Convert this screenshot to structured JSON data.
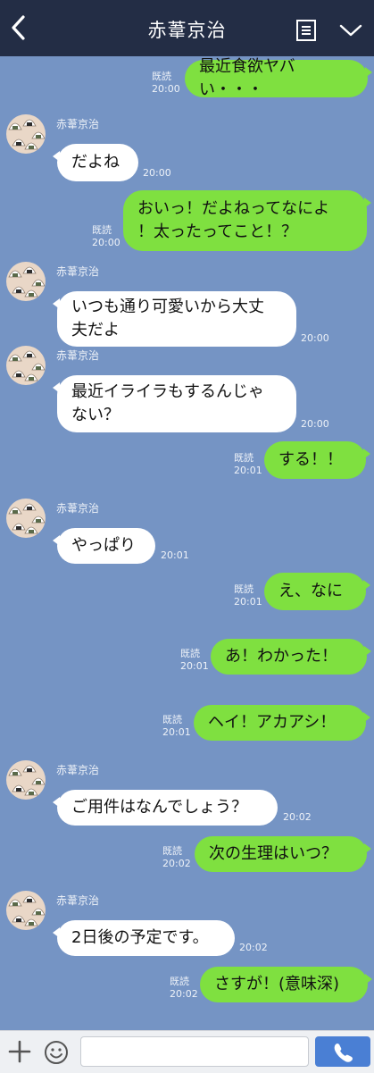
{
  "header": {
    "title": "赤葦京治",
    "back_icon": "chevron-left-icon",
    "menu_icon": "note-icon",
    "more_icon": "chevron-down-icon",
    "bg_color": "#232d45"
  },
  "chat": {
    "bg_color": "#7594c4",
    "read_label": "既読",
    "contact_name": "赤葦京治",
    "messages": [
      {
        "dir": "out",
        "text": "最近食欲ヤバい・・・",
        "time": "20:00",
        "read": "既読"
      },
      {
        "dir": "in",
        "sender": "赤葦京治",
        "text": "だよね",
        "time": "20:00"
      },
      {
        "dir": "out",
        "text": "おいっ！だよねってなによ\n！太ったってこと！？",
        "time": "20:00",
        "read": "既読"
      },
      {
        "dir": "in",
        "sender": "赤葦京治",
        "text": "いつも通り可愛いから大丈\n夫だよ",
        "time": "20:00"
      },
      {
        "dir": "in",
        "sender": "赤葦京治",
        "text": "最近イライラもするんじゃ\nない？",
        "time": "20:00"
      },
      {
        "dir": "out",
        "text": "する！！",
        "time": "20:01",
        "read": "既読"
      },
      {
        "dir": "in",
        "sender": "赤葦京治",
        "text": "やっぱり",
        "time": "20:01"
      },
      {
        "dir": "out",
        "text": "え、なに",
        "time": "20:01",
        "read": "既読"
      },
      {
        "dir": "out",
        "text": "あ！わかった！",
        "time": "20:01",
        "read": "既読"
      },
      {
        "dir": "out",
        "text": "ヘイ！アカアシ！",
        "time": "20:01",
        "read": "既読"
      },
      {
        "dir": "in",
        "sender": "赤葦京治",
        "text": "ご用件はなんでしょう？",
        "time": "20:02"
      },
      {
        "dir": "out",
        "text": "次の生理はいつ？",
        "time": "20:02",
        "read": "既読"
      },
      {
        "dir": "in",
        "sender": "赤葦京治",
        "text": "2日後の予定です。",
        "time": "20:02"
      },
      {
        "dir": "out",
        "text": "さすが！(意味深)",
        "time": "20:02",
        "read": "既読"
      }
    ]
  },
  "footer": {
    "plus_icon": "plus-icon",
    "emoji_icon": "smiley-icon",
    "input_value": "",
    "send_icon": "phone-icon",
    "send_color": "#4a7fd4"
  }
}
